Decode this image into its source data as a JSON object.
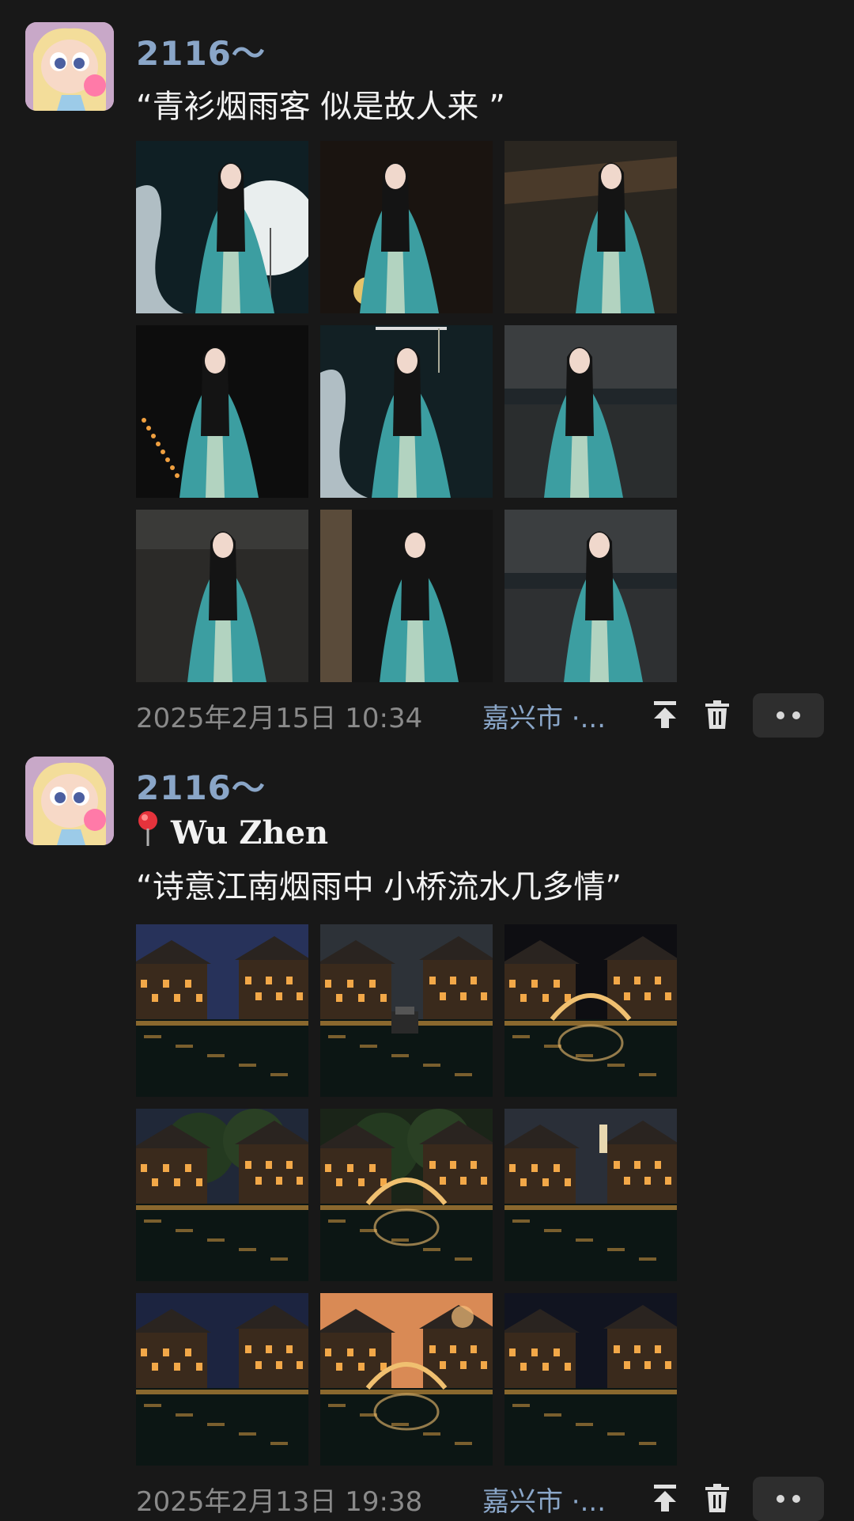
{
  "posts": [
    {
      "user": "2116～",
      "location_tag": "",
      "caption": "“青衫烟雨客 似是故人来 ”",
      "date": "2025年2月15日 10:34",
      "city": "嘉兴市 ·...",
      "photos": [
        {
          "icon": "hanfu-umbrella-lake-photo",
          "theme": "hanfu"
        },
        {
          "icon": "hanfu-fan-lantern-photo",
          "theme": "hanfu"
        },
        {
          "icon": "hanfu-railing-photo",
          "theme": "hanfu"
        },
        {
          "icon": "hanfu-lantern-night-photo",
          "theme": "hanfu"
        },
        {
          "icon": "hanfu-umbrella-pose-photo",
          "theme": "hanfu"
        },
        {
          "icon": "hanfu-street-photo",
          "theme": "hanfu"
        },
        {
          "icon": "hanfu-sitting-photo",
          "theme": "hanfu"
        },
        {
          "icon": "hanfu-boat-photo",
          "theme": "hanfu"
        },
        {
          "icon": "hanfu-house-photo",
          "theme": "hanfu"
        }
      ]
    },
    {
      "user": "2116～",
      "location_tag": "Wu Zhen",
      "caption": "“诗意江南烟雨中 小桥流水几多情”",
      "date": "2025年2月13日 19:38",
      "city": "嘉兴市 ·...",
      "photos": [
        {
          "icon": "wuzhen-houses-night-photo",
          "theme": "town"
        },
        {
          "icon": "wuzhen-canal-boat-photo",
          "theme": "town"
        },
        {
          "icon": "wuzhen-bridge-photo",
          "theme": "town"
        },
        {
          "icon": "wuzhen-willow-canal-photo",
          "theme": "town"
        },
        {
          "icon": "wuzhen-arch-bridge-photo",
          "theme": "town"
        },
        {
          "icon": "wuzhen-pagoda-canal-photo",
          "theme": "town"
        },
        {
          "icon": "wuzhen-riverside-photo",
          "theme": "town"
        },
        {
          "icon": "wuzhen-sunset-bridge-photo",
          "theme": "town"
        },
        {
          "icon": "wuzhen-night-street-photo",
          "theme": "town"
        }
      ]
    }
  ],
  "icons": {
    "pin": "location-pin-icon",
    "pin_top": "pin-to-top-icon",
    "delete": "trash-icon",
    "more": "more-options-icon"
  },
  "colors": {
    "background": "#181818",
    "username": "#8aa6c8",
    "date": "#8a8a8a",
    "city": "#8aa6c8"
  }
}
